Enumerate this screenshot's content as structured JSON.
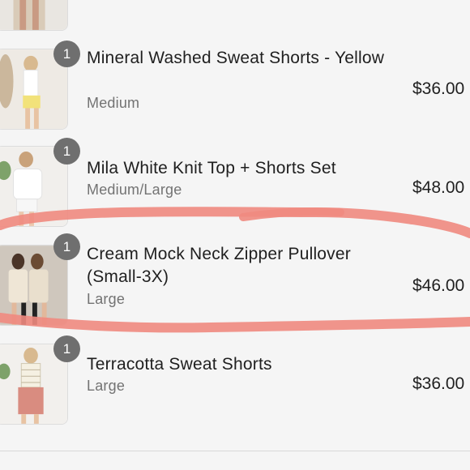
{
  "items": [
    {
      "qty": "1",
      "title": "Mineral Washed Sweat Shorts - Yellow",
      "variant": "Medium",
      "price": "$36.00"
    },
    {
      "qty": "1",
      "title": "Mila White Knit Top + Shorts Set",
      "variant": "Medium/Large",
      "price": "$48.00"
    },
    {
      "qty": "1",
      "title": "Cream Mock Neck Zipper Pullover (Small-3X)",
      "variant": "Large",
      "price": "$46.00"
    },
    {
      "qty": "1",
      "title": "Terracotta Sweat Shorts",
      "variant": "Large",
      "price": "$36.00"
    }
  ],
  "colors": {
    "highlight": "#f08a80",
    "badge": "#6f6f6f",
    "background": "#f5f5f5"
  }
}
